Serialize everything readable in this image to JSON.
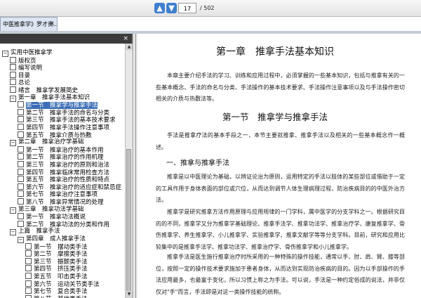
{
  "toolbar": {
    "prev_icon": "arrow-up-icon",
    "next_icon": "arrow-down-icon",
    "current_page": "17",
    "total_pages": "/ 502"
  },
  "tab": {
    "label": "中医推拿学》罗才贵...",
    "close": "×"
  },
  "sidebar": {
    "collapse_icon": "×",
    "items": [
      {
        "label": "实用中医推拿学",
        "level": 0,
        "type": "toggle",
        "sign": "−"
      },
      {
        "label": "版权页",
        "level": 1,
        "type": "box"
      },
      {
        "label": "编写说明",
        "level": 1,
        "type": "box"
      },
      {
        "label": "目录",
        "level": 1,
        "type": "box"
      },
      {
        "label": "总论",
        "level": 1,
        "type": "box"
      },
      {
        "label": "绪言　推拿学发展简史",
        "level": 1,
        "type": "box"
      },
      {
        "label": "第一章　推拿手法基本知识",
        "level": 1,
        "type": "toggle",
        "sign": "−"
      },
      {
        "label": "第一节　推拿学与推拿手法",
        "level": 2,
        "type": "box",
        "selected": true
      },
      {
        "label": "第二节　推拿手法的命名与分类",
        "level": 2,
        "type": "box"
      },
      {
        "label": "第三节　推拿手法的基本技术要求",
        "level": 2,
        "type": "box"
      },
      {
        "label": "第四节　推拿手法操作注意事项",
        "level": 2,
        "type": "box"
      },
      {
        "label": "第五节　推拿介质与热敷",
        "level": 2,
        "type": "box"
      },
      {
        "label": "第二章　推拿治疗学基础",
        "level": 1,
        "type": "toggle",
        "sign": "−"
      },
      {
        "label": "第一节　推拿治疗的基本作用",
        "level": 2,
        "type": "box"
      },
      {
        "label": "第二节　推拿治疗的作用机理",
        "level": 2,
        "type": "box"
      },
      {
        "label": "第三节　推拿治疗的原则和治法",
        "level": 2,
        "type": "box"
      },
      {
        "label": "第四节　推拿临床常用检查方法",
        "level": 2,
        "type": "box"
      },
      {
        "label": "第五节　推拿治疗的性质和特点",
        "level": 2,
        "type": "box"
      },
      {
        "label": "第六节　推拿治疗的适应症和禁忌症",
        "level": 2,
        "type": "box"
      },
      {
        "label": "第七节　推拿治疗注意事项",
        "level": 2,
        "type": "box"
      },
      {
        "label": "第八节　推拿异常情况的处理",
        "level": 2,
        "type": "box"
      },
      {
        "label": "第三章　推拿功法学基础",
        "level": 1,
        "type": "toggle",
        "sign": "−"
      },
      {
        "label": "第一节　推拿功法概说",
        "level": 2,
        "type": "box"
      },
      {
        "label": "第二节　推拿功法的分类和作用",
        "level": 2,
        "type": "box"
      },
      {
        "label": "上篇　推拿手法",
        "level": 1,
        "type": "toggle",
        "sign": "−"
      },
      {
        "label": "第四章　成人推拿手法",
        "level": 2,
        "type": "toggle",
        "sign": "−"
      },
      {
        "label": "第一节　摆动类手法",
        "level": 3,
        "type": "box"
      },
      {
        "label": "第二节　摩擦类手法",
        "level": 3,
        "type": "box"
      },
      {
        "label": "第三节　振颤类手法",
        "level": 3,
        "type": "box"
      },
      {
        "label": "第四节　挤压类手法",
        "level": 3,
        "type": "box"
      },
      {
        "label": "第五节　叩击类手法",
        "level": 3,
        "type": "box"
      },
      {
        "label": "第六节　运动关节类手法",
        "level": 3,
        "type": "box"
      },
      {
        "label": "第七节　复合类手法",
        "level": 3,
        "type": "box"
      },
      {
        "label": "第八节　其他类手法",
        "level": 3,
        "type": "box"
      }
    ]
  },
  "document": {
    "chapter_title": "第一章　推拿手法基本知识",
    "intro": "本章主要介绍手法的学习、训练和应用过程中，必须掌握的一些基本知识，包括与推拿有关的一些基本概念、手法的命名与分类、手法操作的基本技术要求、手法操作注意事项以及与手法操作密切相关的介质与热敷法等。",
    "section_title": "第一节　推拿学与推拿手法",
    "section_intro": "手法是推拿疗法的基本手段之一，本节主要就推拿、推拿手法以及相关的一些基本概念作一概述。",
    "subhead": "一、推拿与推拿手法",
    "para1": "推拿是以中医理论为基础，以辨证论治为原则，运用特定的手法以肢体的某些部位或借助于一定的工具作用于身体表面的部位或穴位，从而达到调节人体生理病理过程，防治疾病目的的中医外治方法。",
    "para2": "推拿学是研究推拿方法作用原理与应用规律的一门学科，属中医学的分支学科之一。根据研究目的的不同，推拿学又分为推拿学基础理论、推拿手法学、推拿功法学、推拿治疗学、康复推拿学、骨伤推拿学、养生推拿学、小儿推拿学、实验推拿学、推拿文献学等等分支学科。目前，研究和应用比较集中的是推拿手法学、推拿功法学、推拿治疗学、骨伤推拿学和小儿推拿学。",
    "para3": "推拿手法是医生施行推拿治疗时所采用的一种特殊的操作技能，通常以手、肘、肩、臂、膝等部位，按照一定的操作技术要求施加于患者身体，从而达到实现防治疾病的目的。因为以手部操作的手法应用最多，也最富于变化，所以习惯上称之为手法。可以说，手法是一种约定俗成的说法，并非仅仅对\"手\"而言，手法即是对这一类操作技能的统称。"
  }
}
